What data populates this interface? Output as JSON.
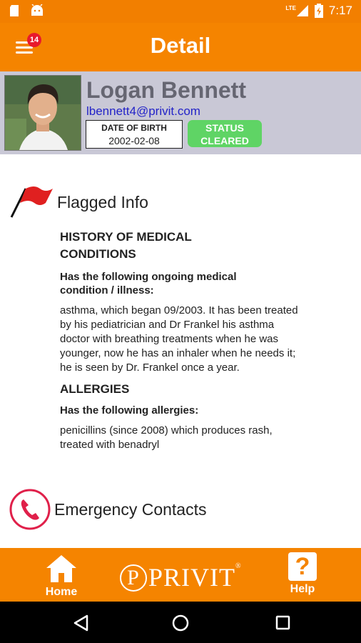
{
  "status_bar": {
    "time": "7:17",
    "network": "LTE"
  },
  "app_bar": {
    "title": "Detail",
    "notification_count": "14"
  },
  "profile": {
    "name": "Logan Bennett",
    "email": "lbennett4@privit.com",
    "dob_label": "DATE OF BIRTH",
    "dob_value": "2002-02-08",
    "status_label": "STATUS",
    "status_value": "CLEARED",
    "status_color": "#5fd465"
  },
  "flagged": {
    "title": "Flagged Info",
    "medical_heading": "HISTORY OF MEDICAL CONDITIONS",
    "medical_sub": "Has the following ongoing medical condition / illness:",
    "medical_text": "asthma, which began 09/2003. It has been treated by his pediatrician and Dr Frankel his asthma doctor with breathing treatments when he was younger, now he has an inhaler when he needs it; he is seen by Dr. Frankel once a year.",
    "allergies_heading": "ALLERGIES",
    "allergies_sub": "Has the following allergies:",
    "allergies_text": "penicillins (since 2008) which produces rash, treated with benadryl"
  },
  "emergency": {
    "title": "Emergency Contacts"
  },
  "bottom_nav": {
    "home_label": "Home",
    "brand": "PRIVIT",
    "help_label": "Help"
  },
  "colors": {
    "brand_orange": "#f58400",
    "flag_red": "#e02020",
    "phone_red": "#e0204a"
  }
}
